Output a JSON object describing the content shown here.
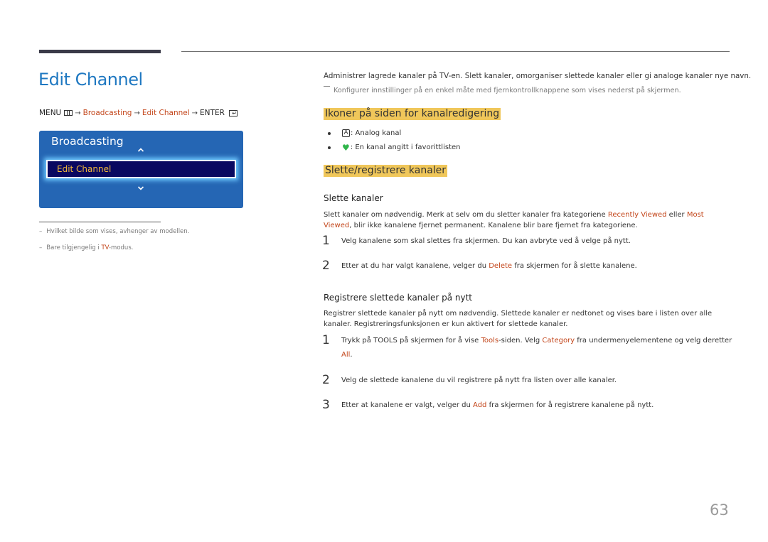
{
  "page": {
    "title": "Edit Channel",
    "page_number": "63"
  },
  "menu_path": {
    "menu": "MENU",
    "menu_icon": "menu-icon",
    "arrow": "→",
    "step1": "Broadcasting",
    "step2": "Edit Channel",
    "enter": "ENTER",
    "enter_icon": "enter-icon"
  },
  "tv_panel": {
    "title": "Broadcasting",
    "selected_item": "Edit Channel",
    "up_icon": "chevron-up-icon",
    "down_icon": "chevron-down-icon"
  },
  "footnotes": [
    {
      "dash": "–",
      "text": "Hvilket bilde som vises, avhenger av modellen."
    },
    {
      "dash": "–",
      "pre": "Bare tilgjengelig i ",
      "hl": "TV",
      "post": "-modus."
    }
  ],
  "intro": {
    "text": "Administrer lagrede kanaler på TV-en. Slett kanaler, omorganiser slettede kanaler eller gi analoge kanaler nye navn.",
    "note": "Konfigurer innstillinger på en enkel måte med fjernkontrollknappene som vises nederst på skjermen."
  },
  "icons_section": {
    "heading": "Ikoner på siden for kanalredigering",
    "items": [
      {
        "icon": "analog-channel-icon",
        "glyph": "A",
        "text": ": Analog kanal"
      },
      {
        "icon": "favorite-heart-icon",
        "glyph": "♥",
        "text": ": En kanal angitt i favorittlisten"
      }
    ]
  },
  "delete_register_section": {
    "heading": "Slette/registrere kanaler",
    "delete": {
      "heading": "Slette kanaler",
      "para_pre": "Slett kanaler om nødvendig. Merk at selv om du sletter kanaler fra kategoriene ",
      "hl1": "Recently Viewed",
      "para_mid": " eller ",
      "hl2": "Most Viewed",
      "para_post": ", blir ikke kanalene fjernet permanent. Kanalene blir bare fjernet fra kategoriene.",
      "steps": [
        {
          "num": "1",
          "pre": "Velg kanalene som skal slettes fra skjermen. Du kan avbryte ved å velge på nytt.",
          "hl": "",
          "post": ""
        },
        {
          "num": "2",
          "pre": "Etter at du har valgt kanalene, velger du ",
          "hl": "Delete",
          "post": " fra skjermen for å slette kanalene."
        }
      ]
    },
    "register": {
      "heading": "Registrere slettede kanaler på nytt",
      "para": "Registrer slettede kanaler på nytt om nødvendig. Slettede kanaler er nedtonet og vises bare i listen over alle kanaler. Registreringsfunksjonen er kun aktivert for slettede kanaler.",
      "steps": [
        {
          "num": "1",
          "pre": "Trykk på TOOLS på skjermen for å vise ",
          "hl": "Tools",
          "mid": "-siden. Velg ",
          "hl2": "Category",
          "post": " fra undermenyelementene og velg deretter",
          "line2": "All",
          "line2_post": "."
        },
        {
          "num": "2",
          "pre": "Velg de slettede kanalene du vil registrere på nytt fra listen over alle kanaler.",
          "hl": "",
          "post": ""
        },
        {
          "num": "3",
          "pre": "Etter at kanalene er valgt, velger du ",
          "hl": "Add",
          "post": " fra skjermen for å registrere kanalene på nytt."
        }
      ]
    }
  },
  "colors": {
    "title_blue": "#1f78c1",
    "highlight_orange": "#c3461b",
    "heading_highlight": "#f0c75a",
    "panel_blue": "#2566b4",
    "selected_bg": "#090860",
    "selected_text": "#f4b93a",
    "heart_green": "#2fb54a"
  }
}
